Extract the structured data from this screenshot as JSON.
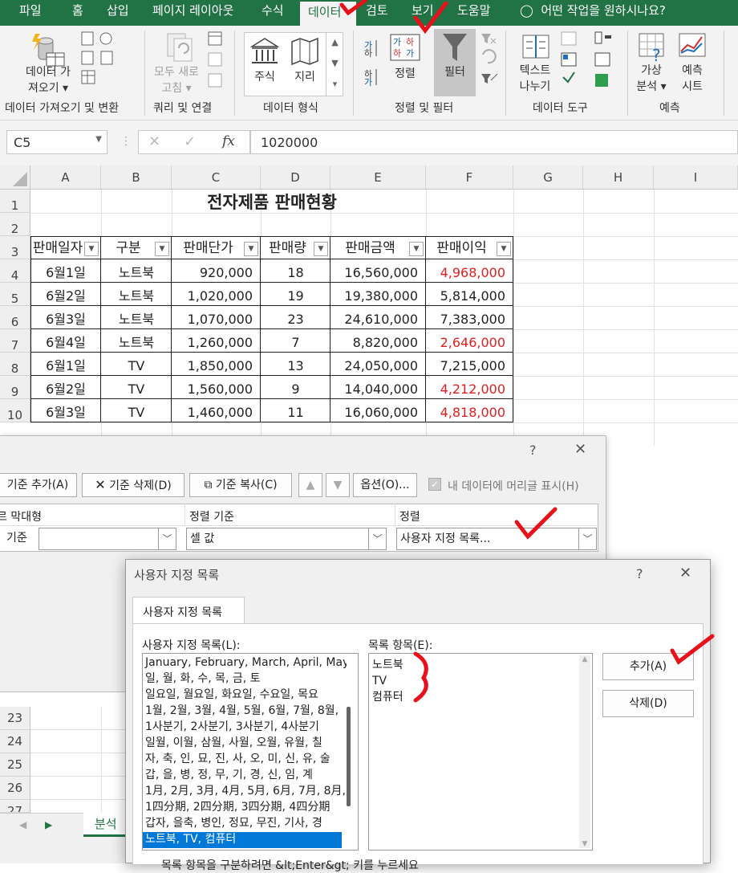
{
  "ribbon": {
    "tabs": [
      "파일",
      "홈",
      "삽입",
      "페이지 레이아웃",
      "수식",
      "데이터",
      "검토",
      "보기",
      "도움말"
    ],
    "active_tab": "데이터",
    "tell_me": "어떤 작업을 원하시나요?",
    "get_data_l1": "데이터 가",
    "get_data_l2": "져오기",
    "refresh_l1": "모두 새로",
    "refresh_l2": "고침",
    "stocks": "주식",
    "geography": "지리",
    "sort": "정렬",
    "filter": "필터",
    "text_to_col_l1": "텍스트",
    "text_to_col_l2": "나누기",
    "whatif_l1": "가상",
    "whatif_l2": "분석",
    "forecast_l1": "예측",
    "forecast_l2": "시트",
    "groups": [
      "데이터 가져오기 및 변환",
      "쿼리 및 연결",
      "데이터 형식",
      "정렬 및 필터",
      "데이터 도구",
      "예측"
    ]
  },
  "formula_bar": {
    "name_box": "C5",
    "formula": "1020000",
    "fx": "fx"
  },
  "sheet": {
    "columns": [
      "A",
      "B",
      "C",
      "D",
      "E",
      "F",
      "G",
      "H",
      "I"
    ],
    "rows": [
      "1",
      "2",
      "3",
      "4",
      "5",
      "6",
      "7",
      "8",
      "9",
      "10"
    ],
    "lower_rows": [
      "23",
      "24",
      "25",
      "26",
      "27"
    ],
    "title": "전자제품 판매현황",
    "headers": [
      "판매일자",
      "구분",
      "판매단가",
      "판매량",
      "판매금액",
      "판매이익"
    ],
    "data": [
      [
        "6월1일",
        "노트북",
        "920,000",
        "18",
        "16,560,000",
        "4,968,000"
      ],
      [
        "6월2일",
        "노트북",
        "1,020,000",
        "19",
        "19,380,000",
        "5,814,000"
      ],
      [
        "6월3일",
        "노트북",
        "1,070,000",
        "23",
        "24,610,000",
        "7,383,000"
      ],
      [
        "6월4일",
        "노트북",
        "1,260,000",
        "7",
        "8,820,000",
        "2,646,000"
      ],
      [
        "6월1일",
        "TV",
        "1,850,000",
        "13",
        "24,050,000",
        "7,215,000"
      ],
      [
        "6월2일",
        "TV",
        "1,560,000",
        "9",
        "14,040,000",
        "4,212,000"
      ],
      [
        "6월3일",
        "TV",
        "1,460,000",
        "11",
        "16,060,000",
        "4,818,000"
      ]
    ],
    "red_rows": [
      0,
      3,
      5,
      6
    ],
    "red_color": "#e02020",
    "sheet_tab": "분석"
  },
  "sort_dialog": {
    "help": "?",
    "close": "✕",
    "add_level": "기준 추가(A)",
    "delete_level": "기준 삭제(D)",
    "copy_level": "기준 복사(C)",
    "options": "옵션(O)...",
    "my_data_has_headers": "내 데이터에 머리글 표시(H)",
    "col_header": "르 막대형",
    "sort_on_header": "정렬 기준",
    "order_header": "정렬",
    "row_label": "기준",
    "sort_on_value": "셀 값",
    "order_value": "사용자 지정 목록..."
  },
  "custom_list_dialog": {
    "title": "사용자 지정 목록",
    "help": "?",
    "close": "✕",
    "tab": "사용자 지정 목록",
    "lists_label": "사용자 지정 목록(L):",
    "entries_label": "목록 항목(E):",
    "lists": [
      "January, February, March, April, May",
      "일, 월, 화, 수, 목, 금, 토",
      "일요일, 월요일, 화요일, 수요일, 목요",
      "1월, 2월, 3월, 4월, 5월, 6월, 7월, 8월,",
      "1사분기, 2사분기, 3사분기, 4사분기",
      "일월, 이월, 삼월, 사월, 오월, 유월, 칠",
      "자, 축, 인, 묘, 진, 사, 오, 미, 신, 유, 술",
      "갑, 을, 병, 정, 무, 기, 경, 신, 임, 계",
      "1月, 2月, 3月, 4月, 5月, 6月, 7月, 8月,",
      "1四分期, 2四分期, 3四分期, 4四分期",
      "갑자, 을축, 병인, 정묘, 무진, 기사, 경",
      "노트북, TV, 컴퓨터"
    ],
    "selected_index": 11,
    "entries": [
      "노트북",
      "TV",
      "컴퓨터"
    ],
    "add": "추가(A)",
    "delete": "삭제(D)",
    "hint": "목록 항목을 구분하려면 &lt;Enter&gt; 키를 누르세요"
  },
  "colors": {
    "excel_green": "#217346",
    "selection_blue": "#0078d7",
    "annotation_red": "#e8101a"
  }
}
